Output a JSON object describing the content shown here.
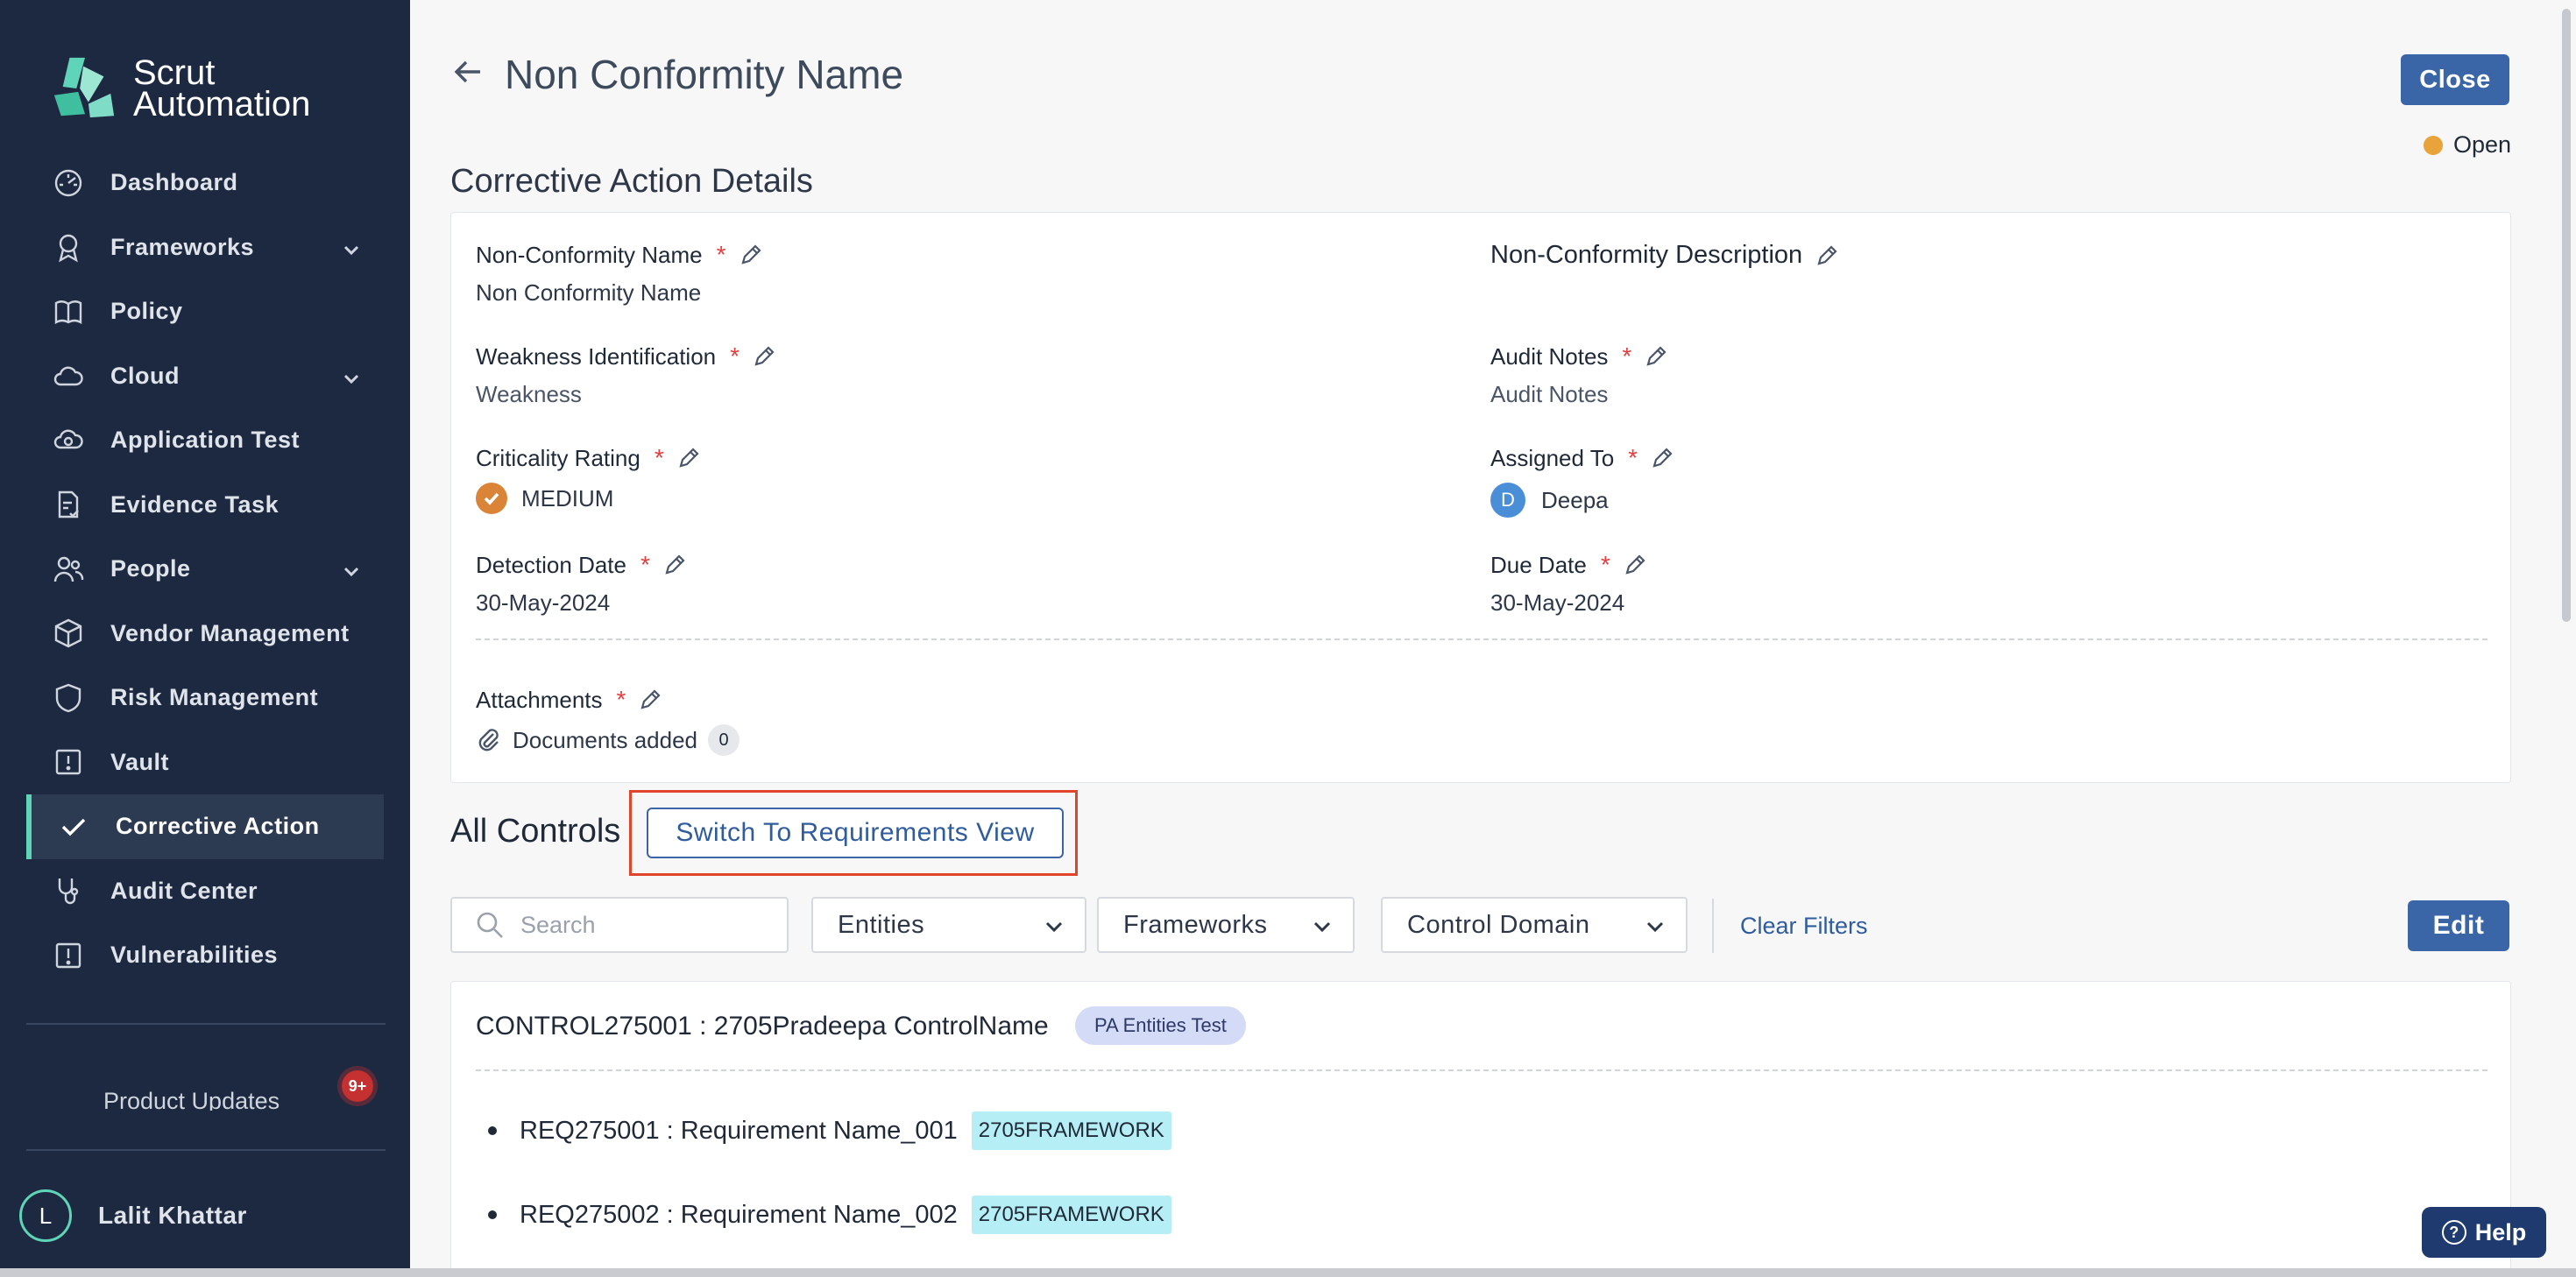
{
  "brand": {
    "line1": "Scrut",
    "line2": "Automation"
  },
  "sidebar": {
    "items": [
      {
        "label": "Dashboard",
        "icon": "dashboard-icon"
      },
      {
        "label": "Frameworks",
        "icon": "award-icon",
        "expandable": true
      },
      {
        "label": "Policy",
        "icon": "book-icon"
      },
      {
        "label": "Cloud",
        "icon": "cloud-icon",
        "expandable": true
      },
      {
        "label": "Application Test",
        "icon": "cloud-refresh-icon"
      },
      {
        "label": "Evidence Task",
        "icon": "file-check-icon"
      },
      {
        "label": "People",
        "icon": "people-icon",
        "expandable": true
      },
      {
        "label": "Vendor Management",
        "icon": "box-icon"
      },
      {
        "label": "Risk Management",
        "icon": "shield-icon"
      },
      {
        "label": "Vault",
        "icon": "vault-icon"
      },
      {
        "label": "Corrective Action",
        "icon": "check-icon",
        "active": true
      },
      {
        "label": "Audit Center",
        "icon": "stethoscope-icon"
      },
      {
        "label": "Vulnerabilities",
        "icon": "alert-square-icon"
      }
    ],
    "updates_label": "Product Updates",
    "updates_badge": "9+",
    "user": {
      "initial": "L",
      "name": "Lalit Khattar"
    }
  },
  "header": {
    "title": "Non Conformity Name",
    "close_label": "Close",
    "status": "Open"
  },
  "details": {
    "section_title": "Corrective Action Details",
    "nc_name_label": "Non-Conformity Name",
    "nc_name_value": "Non Conformity Name",
    "nc_desc_label": "Non-Conformity Description",
    "weakness_label": "Weakness Identification",
    "weakness_value": "Weakness",
    "audit_notes_label": "Audit Notes",
    "audit_notes_value": "Audit Notes",
    "criticality_label": "Criticality Rating",
    "criticality_value": "MEDIUM",
    "assigned_label": "Assigned To",
    "assigned_initial": "D",
    "assigned_value": "Deepa",
    "detection_label": "Detection Date",
    "detection_value": "30-May-2024",
    "due_label": "Due Date",
    "due_value": "30-May-2024",
    "attachments_label": "Attachments",
    "attachments_value": "Documents added",
    "attachments_count": "0",
    "required_mark": "*"
  },
  "controls": {
    "title": "All Controls",
    "switch_label": "Switch To Requirements View",
    "search_placeholder": "Search",
    "filters": [
      "Entities",
      "Frameworks",
      "Control Domain"
    ],
    "clear_label": "Clear Filters",
    "edit_label": "Edit",
    "control_title": "CONTROL275001 : 2705Pradeepa ControlName",
    "entity_badge": "PA Entities Test",
    "requirements": [
      {
        "label": "REQ275001 : Requirement Name_001",
        "framework": "2705FRAMEWORK"
      },
      {
        "label": "REQ275002 : Requirement Name_002",
        "framework": "2705FRAMEWORK"
      }
    ]
  },
  "help_label": "Help",
  "colors": {
    "sidebar_bg": "#1d2940",
    "accent": "#3a66a8",
    "status_open": "#e8a33a",
    "active_bar": "#5fd4b8"
  }
}
